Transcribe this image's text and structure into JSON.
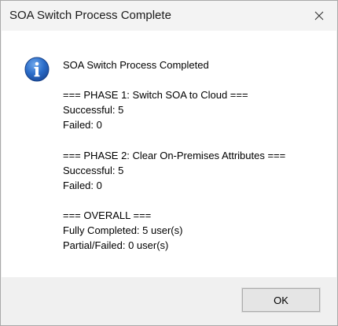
{
  "window": {
    "title": "SOA Switch Process Complete",
    "close_icon": "close-icon"
  },
  "message": {
    "icon": "info-icon",
    "heading": "SOA Switch Process Completed",
    "phase1": {
      "header": "=== PHASE 1: Switch SOA to Cloud ===",
      "successful": "Successful: 5",
      "failed": "Failed: 0"
    },
    "phase2": {
      "header": "=== PHASE 2: Clear On-Premises Attributes ===",
      "successful": "Successful: 5",
      "failed": "Failed: 0"
    },
    "overall": {
      "header": "=== OVERALL ===",
      "fully_completed": "Fully Completed: 5 user(s)",
      "partial_failed": "Partial/Failed: 0 user(s)"
    }
  },
  "buttons": {
    "ok_label": "OK"
  },
  "colors": {
    "content_background": "#ffffff",
    "footer_background": "#f0f0f0",
    "info_icon_blue": "#1f5fb8"
  }
}
